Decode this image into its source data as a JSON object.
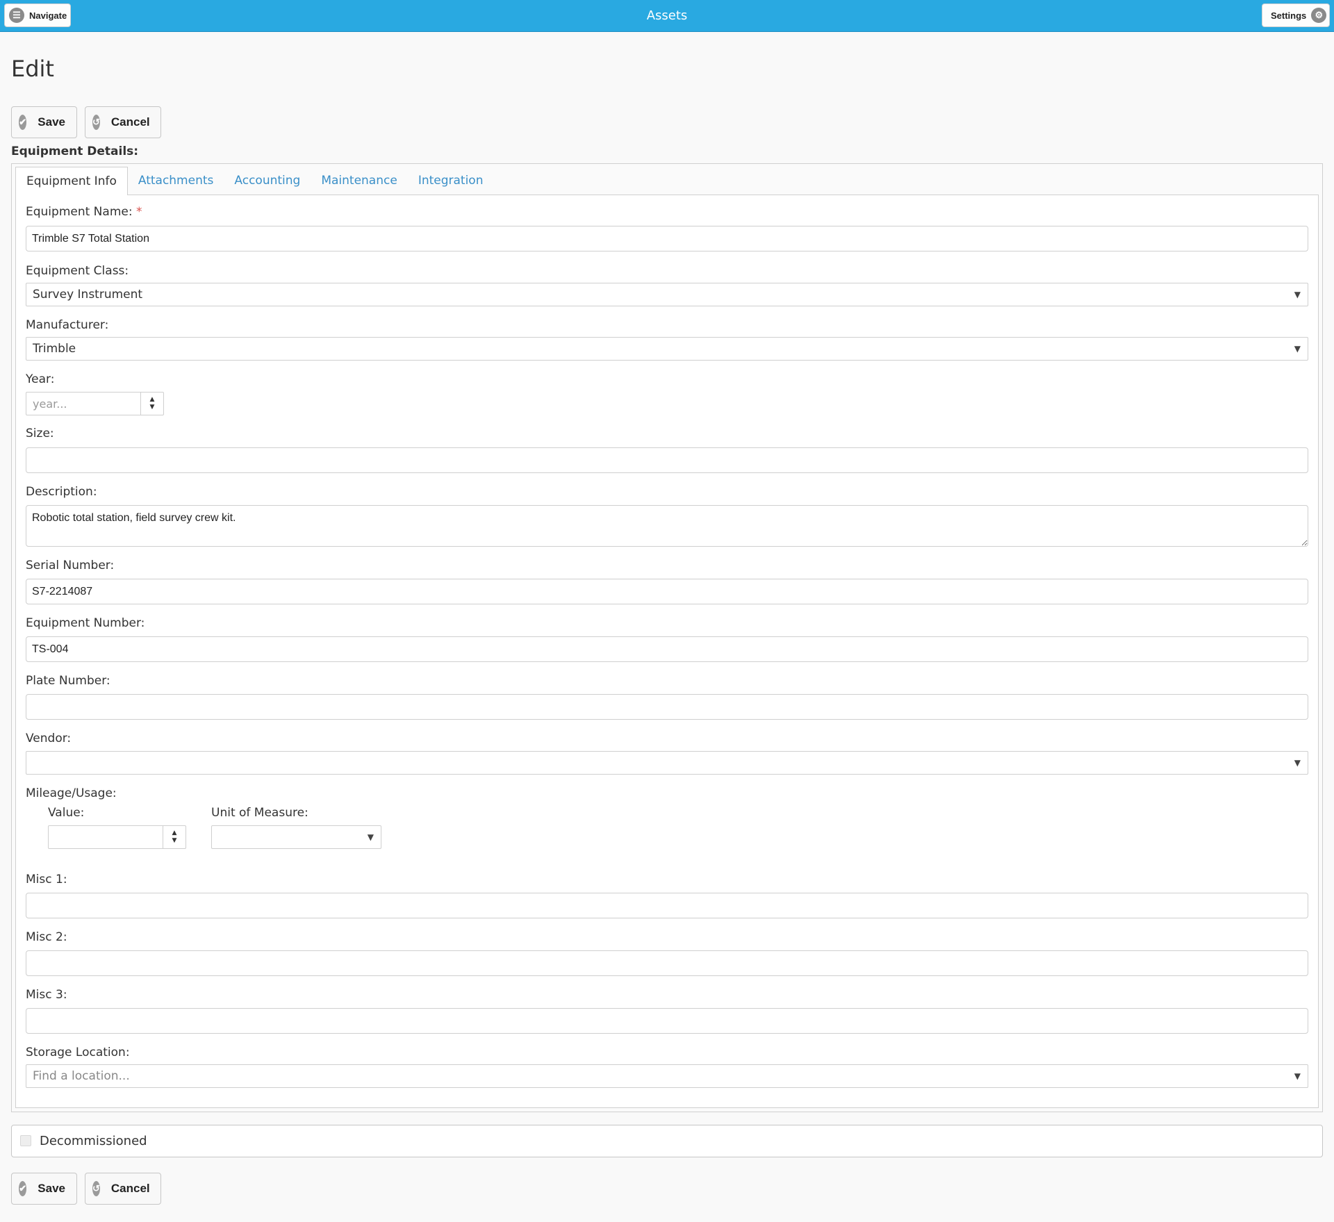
{
  "header": {
    "title": "Assets",
    "navigate_label": "Navigate",
    "settings_label": "Settings"
  },
  "page": {
    "title": "Edit",
    "section_label": "Equipment Details:"
  },
  "actions": {
    "save_label": "Save",
    "cancel_label": "Cancel"
  },
  "tabs": [
    {
      "label": "Equipment Info",
      "active": true
    },
    {
      "label": "Attachments"
    },
    {
      "label": "Accounting"
    },
    {
      "label": "Maintenance"
    },
    {
      "label": "Integration"
    }
  ],
  "form": {
    "equipment_name": {
      "label": "Equipment Name:",
      "required_mark": "*",
      "value": "Trimble S7 Total Station"
    },
    "equipment_class": {
      "label": "Equipment Class:",
      "value": "Survey Instrument"
    },
    "manufacturer": {
      "label": "Manufacturer:",
      "value": "Trimble"
    },
    "year": {
      "label": "Year:",
      "placeholder": "year..."
    },
    "size": {
      "label": "Size:",
      "value": ""
    },
    "description": {
      "label": "Description:",
      "value": "Robotic total station, field survey crew kit."
    },
    "serial_number": {
      "label": "Serial Number:",
      "value": "S7-2214087"
    },
    "equipment_number": {
      "label": "Equipment Number:",
      "value": "TS-004"
    },
    "plate_number": {
      "label": "Plate Number:",
      "value": ""
    },
    "vendor": {
      "label": "Vendor:",
      "value": ""
    },
    "mileage": {
      "label": "Mileage/Usage:",
      "value_label": "Value:",
      "unit_label": "Unit of Measure:"
    },
    "misc1": {
      "label": "Misc 1:",
      "value": ""
    },
    "misc2": {
      "label": "Misc 2:",
      "value": ""
    },
    "misc3": {
      "label": "Misc 3:",
      "value": ""
    },
    "storage_location": {
      "label": "Storage Location:",
      "placeholder": "Find a location..."
    }
  },
  "decommissioned": {
    "label": "Decommissioned",
    "checked": false
  },
  "icons": {
    "navigate": "menu-icon",
    "settings": "gear-icon",
    "save": "check-icon",
    "cancel": "undo-icon",
    "dropdown": "caret-down-icon",
    "spinner": "spinner-arrows-icon"
  },
  "colors": {
    "header_bg": "#29a9e1",
    "tab_link": "#3a8fc8",
    "required": "#d9534f"
  }
}
